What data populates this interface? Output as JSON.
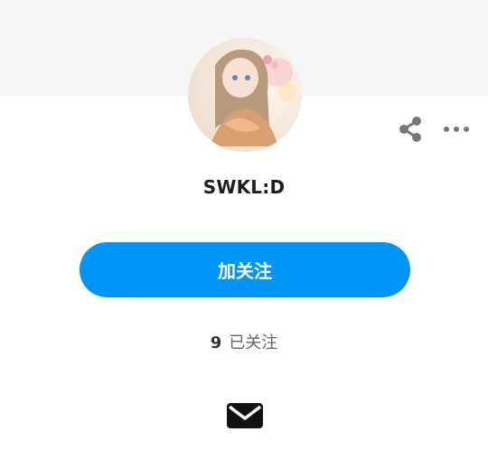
{
  "profile": {
    "username": "SWKL:D",
    "follow_label": "加关注",
    "following_count": "9",
    "following_label": "已关注"
  },
  "icons": {
    "share": "share-icon",
    "more": "more-dots-icon",
    "message": "envelope-icon"
  },
  "colors": {
    "accent": "#0095f6",
    "header_bg": "#f6f6f6",
    "icon_gray": "#777777"
  }
}
